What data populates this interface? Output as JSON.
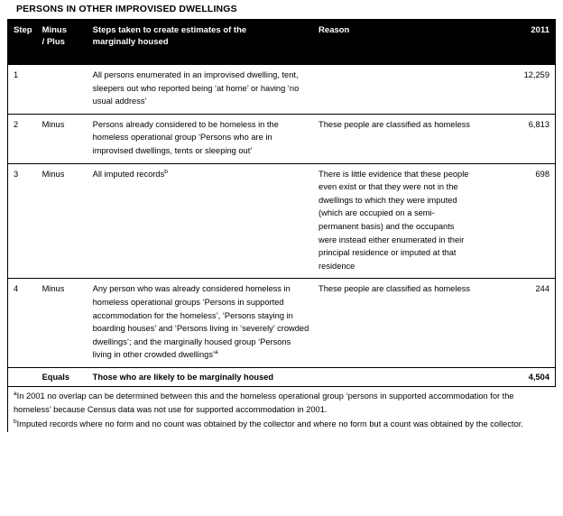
{
  "document": {
    "title": "PERSONS IN OTHER IMPROVISED DWELLINGS"
  },
  "table": {
    "headers": {
      "step": "Step",
      "sign": "Minus / Plus",
      "sign_line1": "Minus",
      "sign_line2": "/ Plus",
      "steps": "Steps taken to create estimates of the marginally housed",
      "steps_line1": "Steps taken to create estimates of the",
      "steps_line2": "marginally housed",
      "reason": "Reason",
      "year": "2011"
    },
    "rows": [
      {
        "step": "1",
        "sign": "",
        "steps": "All persons enumerated in an improvised dwelling, tent, sleepers out who reported being ‘at home’ or having ‘no usual address’",
        "steps_sup": "",
        "reason": "",
        "value": "12,259"
      },
      {
        "step": "2",
        "sign": "Minus",
        "steps": "Persons already considered to be homeless in the homeless operational group ‘Persons who are in improvised dwellings, tents or sleeping out’",
        "steps_sup": "",
        "reason": "These people are classified as homeless",
        "value": "6,813"
      },
      {
        "step": "3",
        "sign": "Minus",
        "steps": "All imputed records",
        "steps_sup": "b",
        "reason": "There is little evidence that these people even exist or that they were not in the dwellings to which they were imputed (which are occupied on a semi-permanent basis) and the occupants were instead either enumerated in their principal residence or imputed at that residence",
        "value": "698"
      },
      {
        "step": "4",
        "sign": "Minus",
        "steps": "Any person who was already considered homeless in homeless operational groups ‘Persons in supported accommodation for the homeless’, ‘Persons staying in boarding houses’ and ‘Persons living in ‘severely’ crowded dwellings’; and the marginally housed group ‘Persons living in other crowded dwellings’",
        "steps_sup": "a",
        "reason": "These people are classified as homeless",
        "value": "244"
      }
    ],
    "total_row": {
      "step": "",
      "sign": "Equals",
      "steps": "Those who are likely to be marginally  housed",
      "reason": "",
      "value": "4,504"
    }
  },
  "footnotes": [
    {
      "marker": "a",
      "text": "In 2001 no overlap can be determined between this and the  homeless operational group ‘persons in supported accommodation  for the homeless’ because Census data was not use for supported accommodation in 2001."
    },
    {
      "marker": "b",
      "text": "Imputed records where no form and no count was obtained by the collector and where no form but a count was obtained by the collector."
    }
  ],
  "colors": {
    "header_background": "#000000",
    "header_text": "#ffffff",
    "body_text": "#000000",
    "page_background": "#ffffff",
    "border": "#000000"
  }
}
